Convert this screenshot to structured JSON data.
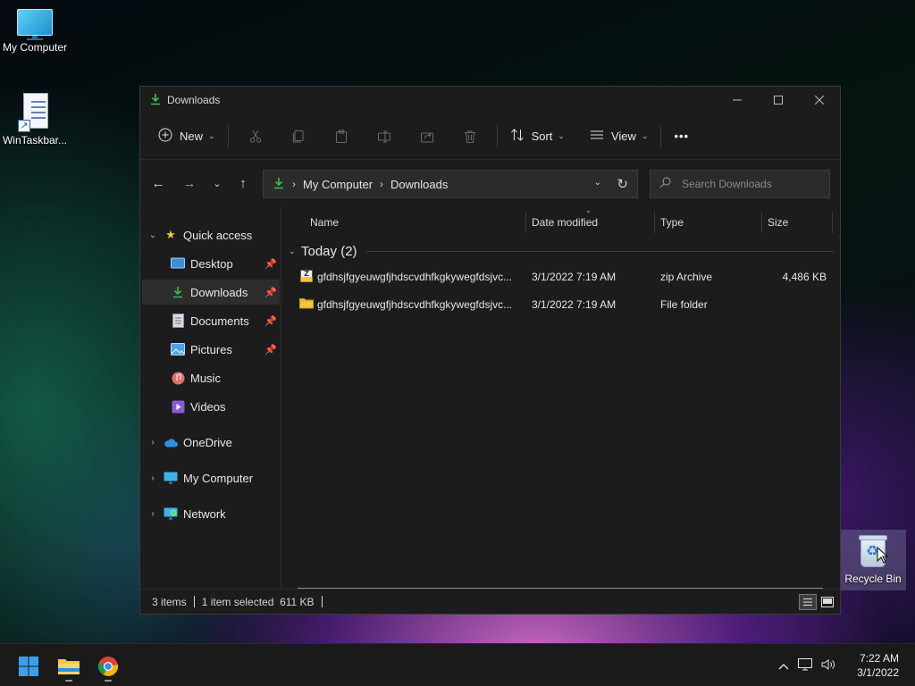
{
  "desktop": {
    "icons": [
      {
        "label": "My Computer"
      },
      {
        "label": "WinTaskbar..."
      },
      {
        "label": "Recycle Bin"
      }
    ]
  },
  "window": {
    "title": "Downloads",
    "toolbar": {
      "new_label": "New",
      "sort_label": "Sort",
      "view_label": "View",
      "more_label": "•••"
    },
    "address": {
      "crumbs": [
        "My Computer",
        "Downloads"
      ]
    },
    "search": {
      "placeholder": "Search Downloads"
    },
    "sidebar": {
      "items": [
        {
          "label": "Quick access"
        },
        {
          "label": "Desktop",
          "pinned": true
        },
        {
          "label": "Downloads",
          "pinned": true,
          "selected": true
        },
        {
          "label": "Documents",
          "pinned": true
        },
        {
          "label": "Pictures",
          "pinned": true
        },
        {
          "label": "Music"
        },
        {
          "label": "Videos"
        },
        {
          "label": "OneDrive"
        },
        {
          "label": "My Computer"
        },
        {
          "label": "Network"
        }
      ]
    },
    "columns": [
      "Name",
      "Date modified",
      "Type",
      "Size"
    ],
    "group": {
      "title": "Today (2)"
    },
    "files": [
      {
        "name": "gfdhsjfgyeuwgfjhdscvdhfkgkywegfdsjvc...",
        "date": "3/1/2022 7:19 AM",
        "type": "zip Archive",
        "size": "4,486 KB",
        "icon": "zip-archive-icon"
      },
      {
        "name": "gfdhsjfgyeuwgfjhdscvdhfkgkywegfdsjvc...",
        "date": "3/1/2022 7:19 AM",
        "type": "File folder",
        "size": "",
        "icon": "folder-icon"
      }
    ],
    "status": {
      "items": "3 items",
      "selected": "1 item selected  611 KB"
    }
  },
  "taskbar": {
    "time": "7:22 AM",
    "date": "3/1/2022"
  },
  "colors": {
    "accent": "#0078d4",
    "window_bg": "#1c1c1c",
    "folder_yellow": "#f4c542",
    "download_green": "#3fb950"
  }
}
